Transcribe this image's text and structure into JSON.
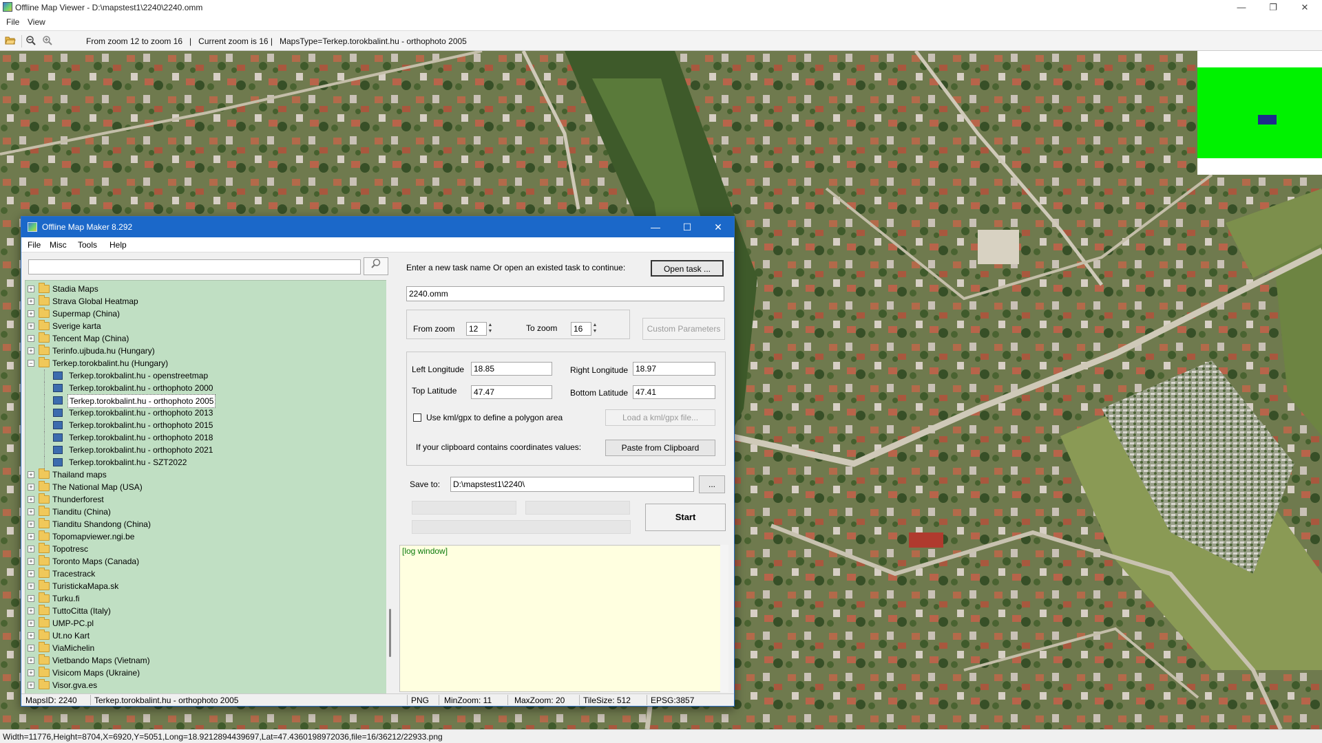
{
  "window": {
    "title": "Offline Map Viewer - D:\\mapstest1\\2240\\2240.omm",
    "menu": [
      "File",
      "View"
    ],
    "toolbar_text": "From zoom 12 to zoom 16   |   Current zoom is 16 |   MapsType=Terkep.torokbalint.hu - orthophoto 2005",
    "status": "Width=11776,Height=8704,X=6920,Y=5051,Long=18.9212894439697,Lat=47.4360198972036,file=16/36212/22933.png"
  },
  "icons": {
    "open": "folder-open-icon",
    "zoom_out": "zoom-out-icon",
    "zoom_in": "zoom-in-icon",
    "search": "search-icon",
    "minimize": "minimize-icon",
    "maximize": "maximize-icon",
    "close": "close-icon"
  },
  "dialog": {
    "title": "Offline Map Maker 8.292",
    "menu": [
      "File",
      "Misc",
      "Tools",
      "Help"
    ],
    "search_value": "",
    "tree": [
      {
        "label": "Stadia Maps",
        "type": "folder"
      },
      {
        "label": "Strava Global Heatmap",
        "type": "folder"
      },
      {
        "label": "Supermap (China)",
        "type": "folder"
      },
      {
        "label": "Sverige karta",
        "type": "folder"
      },
      {
        "label": "Tencent Map (China)",
        "type": "folder"
      },
      {
        "label": "Terinfo.ujbuda.hu (Hungary)",
        "type": "folder"
      },
      {
        "label": "Terkep.torokbalint.hu (Hungary)",
        "type": "folder-open"
      },
      {
        "label": "Terkep.torokbalint.hu - openstreetmap",
        "type": "map"
      },
      {
        "label": "Terkep.torokbalint.hu - orthophoto 2000",
        "type": "map"
      },
      {
        "label": "Terkep.torokbalint.hu - orthophoto 2005",
        "type": "map",
        "selected": true
      },
      {
        "label": "Terkep.torokbalint.hu - orthophoto 2013",
        "type": "map"
      },
      {
        "label": "Terkep.torokbalint.hu - orthophoto 2015",
        "type": "map"
      },
      {
        "label": "Terkep.torokbalint.hu - orthophoto 2018",
        "type": "map"
      },
      {
        "label": "Terkep.torokbalint.hu - orthophoto 2021",
        "type": "map"
      },
      {
        "label": "Terkep.torokbalint.hu - SZT2022",
        "type": "map"
      },
      {
        "label": "Thailand maps",
        "type": "folder"
      },
      {
        "label": "The National Map (USA)",
        "type": "folder"
      },
      {
        "label": "Thunderforest",
        "type": "folder"
      },
      {
        "label": "Tianditu (China)",
        "type": "folder"
      },
      {
        "label": "Tianditu Shandong (China)",
        "type": "folder"
      },
      {
        "label": "Topomapviewer.ngi.be",
        "type": "folder"
      },
      {
        "label": "Topotresc",
        "type": "folder"
      },
      {
        "label": "Toronto Maps (Canada)",
        "type": "folder"
      },
      {
        "label": "Tracestrack",
        "type": "folder"
      },
      {
        "label": "TuristickaMapa.sk",
        "type": "folder"
      },
      {
        "label": "Turku.fi",
        "type": "folder"
      },
      {
        "label": "TuttoCitta (Italy)",
        "type": "folder"
      },
      {
        "label": "UMP-PC.pl",
        "type": "folder"
      },
      {
        "label": "Ut.no Kart",
        "type": "folder"
      },
      {
        "label": "ViaMichelin",
        "type": "folder"
      },
      {
        "label": "Vietbando Maps (Vietnam)",
        "type": "folder"
      },
      {
        "label": "Visicom Maps (Ukraine)",
        "type": "folder"
      },
      {
        "label": "Visor.gva.es",
        "type": "folder"
      }
    ],
    "task_prompt": "Enter a new task name Or open an existed task to continue:",
    "open_task_label": "Open task ...",
    "task_name": "2240.omm",
    "from_zoom_label": "From zoom",
    "from_zoom": "12",
    "to_zoom_label": "To zoom",
    "to_zoom": "16",
    "custom_params_label": "Custom Parameters",
    "left_lon_label": "Left Longitude",
    "left_lon": "18.85",
    "right_lon_label": "Right Longitude",
    "right_lon": "18.97",
    "top_lat_label": "Top Latitude",
    "top_lat": "47.47",
    "bottom_lat_label": "Bottom Latitude",
    "bottom_lat": "47.41",
    "kml_label": "Use kml/gpx to define a polygon area",
    "load_kml_label": "Load a kml/gpx file...",
    "clipboard_text": "If your clipboard contains coordinates values:",
    "paste_label": "Paste from Clipboard",
    "save_to_label": "Save to:",
    "save_to": "D:\\mapstest1\\2240\\",
    "browse_label": "...",
    "start_label": "Start",
    "log_text": "[log window]",
    "status": {
      "maps_id": "MapsID: 2240",
      "maps_name": "Terkep.torokbalint.hu - orthophoto 2005",
      "format": "PNG",
      "min_zoom": "MinZoom: 11",
      "max_zoom": "MaxZoom: 20",
      "tile_size": "TileSize: 512",
      "epsg": "EPSG:3857"
    }
  }
}
